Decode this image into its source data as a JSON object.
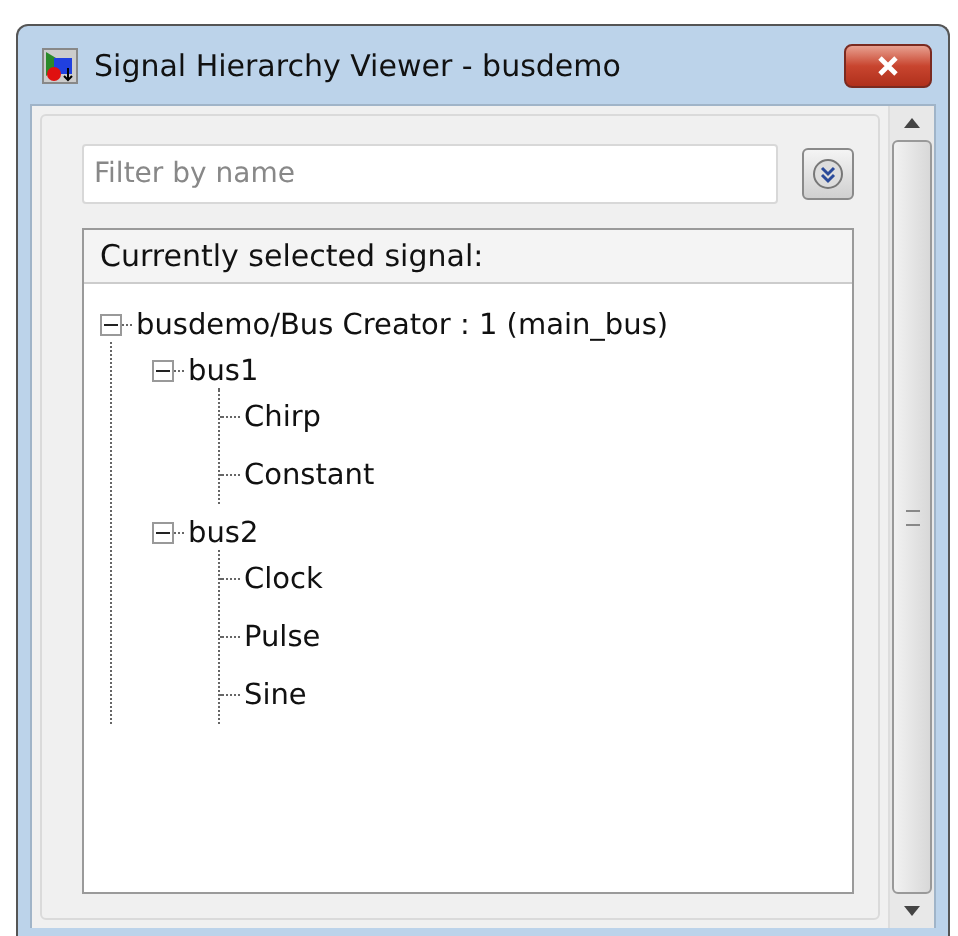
{
  "window": {
    "title": "Signal Hierarchy Viewer - busdemo"
  },
  "filter": {
    "placeholder": "Filter by name"
  },
  "tree": {
    "header": "Currently selected signal:",
    "items": [
      {
        "label": "busdemo/Bus Creator : 1 (main_bus)",
        "expanded": true,
        "children": [
          {
            "label": "bus1",
            "expanded": true,
            "children": [
              {
                "label": "Chirp"
              },
              {
                "label": "Constant"
              }
            ]
          },
          {
            "label": "bus2",
            "expanded": true,
            "children": [
              {
                "label": "Clock"
              },
              {
                "label": "Pulse"
              },
              {
                "label": "Sine"
              }
            ]
          }
        ]
      }
    ]
  }
}
